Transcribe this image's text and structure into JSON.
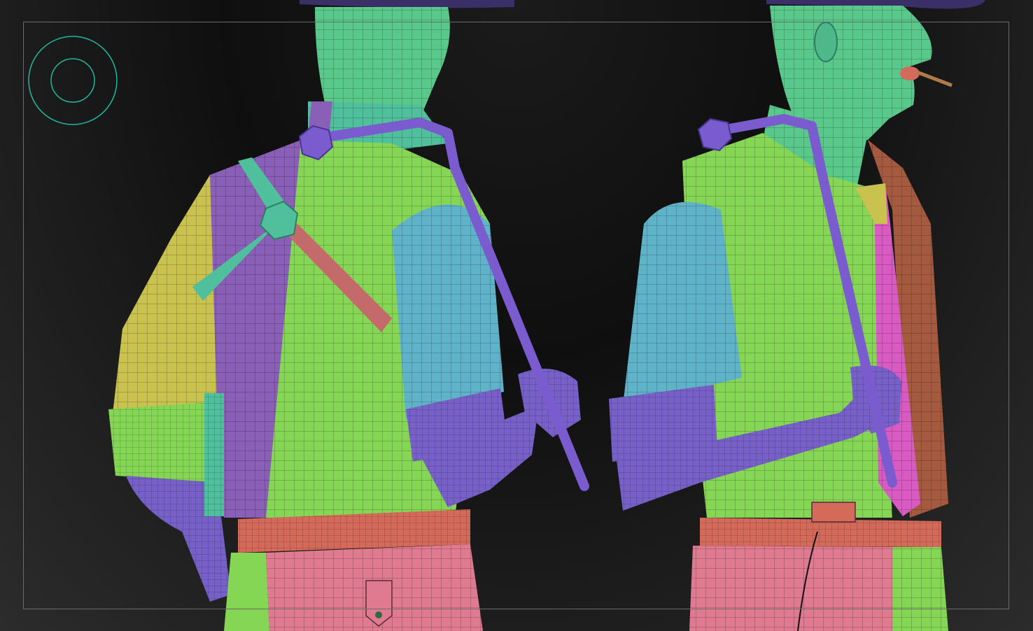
{
  "viewport": {
    "background": "#141414",
    "frame_color": "#6a6a6a",
    "gizmo_color": "#1fb89a"
  },
  "model": {
    "description_colors": {
      "skin_green": "#58c98a",
      "shirt_green": "#86d655",
      "shirt_blue": "#5fb3c9",
      "purple": "#7761c8",
      "violet_panel": "#8a5fb8",
      "yellow": "#c9c24f",
      "pink": "#df7a90",
      "teal": "#4fbf9c",
      "brown": "#a5593e",
      "magenta": "#d85ac2",
      "belt": "#d46a5a"
    }
  }
}
